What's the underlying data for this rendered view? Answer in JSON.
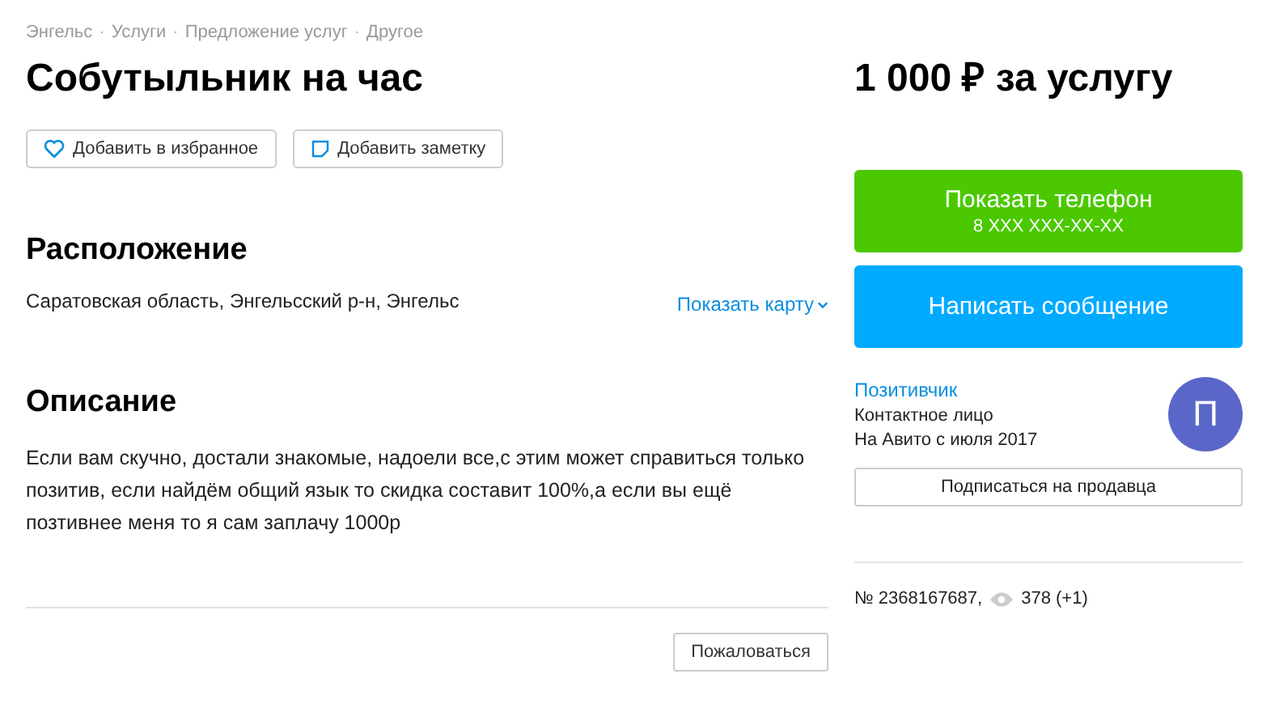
{
  "breadcrumbs": [
    "Энгельс",
    "Услуги",
    "Предложение услуг",
    "Другое"
  ],
  "breadcrumb_separator": "·",
  "title": "Собутыльник на час",
  "actions": [
    {
      "label": "Добавить в избранное"
    },
    {
      "label": "Добавить заметку"
    }
  ],
  "location": {
    "heading": "Расположение",
    "address": "Саратовская область, Энгельсский р-н, Энгельс",
    "map_link": "Показать карту"
  },
  "description": {
    "heading": "Описание",
    "text": "Если вам скучно, достали знакомые, надоели все,с этим может справиться только позитив, если найдём общий язык то скидка составит 100%,а если вы ещё позтивнее меня то я сам заплачу 1000р"
  },
  "report_button": "Пожаловаться",
  "price": "1 000 ₽ за услугу",
  "phone_button": {
    "label": "Показать телефон",
    "number": "8 XXX XXX-XX-XX"
  },
  "message_button": "Написать сообщение",
  "seller": {
    "name": "Позитивчик",
    "role": "Контактное лицо",
    "since": "На Авито с июля 2017",
    "avatar_letter": "П"
  },
  "subscribe_button": "Подписаться на продавца",
  "listing_number": "№ 2368167687,",
  "views": "378 (+1)"
}
